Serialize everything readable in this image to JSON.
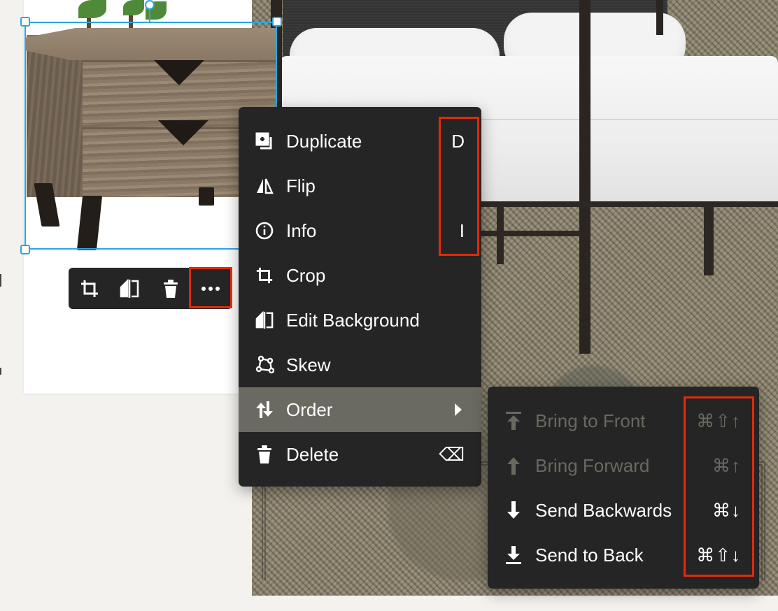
{
  "toolbar": {
    "buttons": [
      {
        "name": "crop-icon"
      },
      {
        "name": "flip-horizontal-icon"
      },
      {
        "name": "trash-icon"
      },
      {
        "name": "more-options-icon"
      }
    ]
  },
  "context_menu": {
    "items": [
      {
        "label": "Duplicate",
        "shortcut": "D",
        "icon": "duplicate-icon"
      },
      {
        "label": "Flip",
        "shortcut": "",
        "icon": "flip-icon"
      },
      {
        "label": "Info",
        "shortcut": "I",
        "icon": "info-icon"
      },
      {
        "label": "Crop",
        "shortcut": "",
        "icon": "crop-icon"
      },
      {
        "label": "Edit Background",
        "shortcut": "",
        "icon": "edit-background-icon"
      },
      {
        "label": "Skew",
        "shortcut": "",
        "icon": "skew-icon"
      },
      {
        "label": "Order",
        "shortcut": "",
        "icon": "order-icon",
        "has_submenu": true,
        "active": true
      },
      {
        "label": "Delete",
        "shortcut": "⌫",
        "icon": "trash-icon"
      }
    ]
  },
  "order_submenu": {
    "items": [
      {
        "label": "Bring to Front",
        "shortcut": "⌘⇧↑",
        "icon": "bring-to-front-icon",
        "disabled": true
      },
      {
        "label": "Bring Forward",
        "shortcut": "⌘↑",
        "icon": "bring-forward-icon",
        "disabled": true
      },
      {
        "label": "Send Backwards",
        "shortcut": "⌘↓",
        "icon": "send-backwards-icon",
        "disabled": false
      },
      {
        "label": "Send to Back",
        "shortcut": "⌘⇧↓",
        "icon": "send-to-back-icon",
        "disabled": false
      }
    ]
  },
  "colors": {
    "menu_bg": "#252525",
    "menu_active": "#6b6a60",
    "highlight": "#e22a0b",
    "selection": "#2aa6e3",
    "disabled_text": "#696960"
  }
}
